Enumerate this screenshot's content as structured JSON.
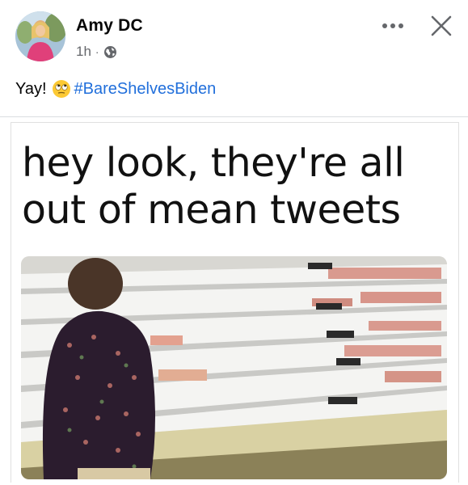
{
  "post": {
    "author": "Amy DC",
    "time": "1h",
    "separator": "·",
    "privacy_icon": "globe-icon",
    "caption_prefix": "Yay!",
    "caption_emoji": "face-with-rolling-eyes",
    "hashtag": "#BareShelvesBiden"
  },
  "meme": {
    "line1": "hey look, they're all",
    "line2": "out of mean tweets"
  },
  "colors": {
    "hashtag": "#216fdb",
    "meta": "#65676b",
    "text": "#050505"
  }
}
